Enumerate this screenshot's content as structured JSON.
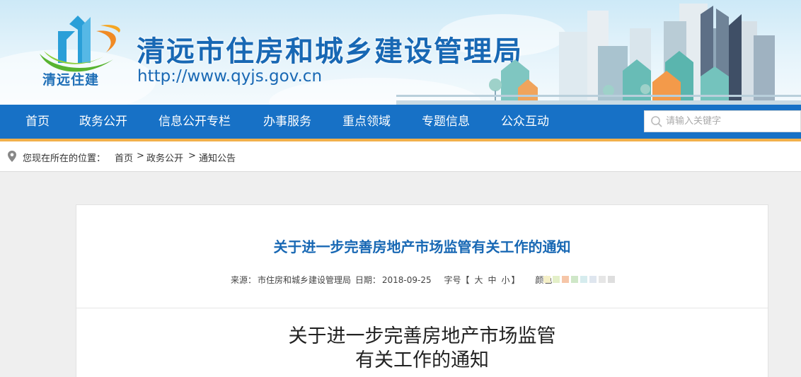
{
  "header": {
    "logo_text": "清远住建",
    "site_title": "清远市住房和城乡建设管理局",
    "site_url": "http://www.qyjs.gov.cn"
  },
  "nav": {
    "items": [
      {
        "label": "首页"
      },
      {
        "label": "政务公开"
      },
      {
        "label": "信息公开专栏"
      },
      {
        "label": "办事服务"
      },
      {
        "label": "重点领域"
      },
      {
        "label": "专题信息"
      },
      {
        "label": "公众互动"
      }
    ],
    "search": {
      "placeholder": "请输入关键字"
    }
  },
  "breadcrumb": {
    "prefix": "您现在所在的位置：",
    "items": [
      "首页",
      "政务公开",
      "通知公告"
    ],
    "separator": ">"
  },
  "article": {
    "title": "关于进一步完善房地产市场监管有关工作的通知",
    "meta": {
      "source_label": "来源：",
      "source": "市住房和城乡建设管理局",
      "date_label": "日期：",
      "date": "2018-09-25",
      "fontsize_label": "字号【",
      "fontsize_options": [
        "大",
        "中",
        "小"
      ],
      "fontsize_close": "】",
      "color_label": "颜色"
    },
    "swatch_colors": [
      "#f5f0c8",
      "#e3efc8",
      "#f6c6a8",
      "#cfe7c8",
      "#d6ecee",
      "#dfe6ef",
      "#e6e6e6",
      "#dedede"
    ],
    "body_title_line1": "关于进一步完善房地产市场监管",
    "body_title_line2": "有关工作的通知"
  },
  "colors": {
    "brand_blue": "#1868b4",
    "nav_blue": "#1771c6",
    "nav_accent": "#f2b04a"
  }
}
